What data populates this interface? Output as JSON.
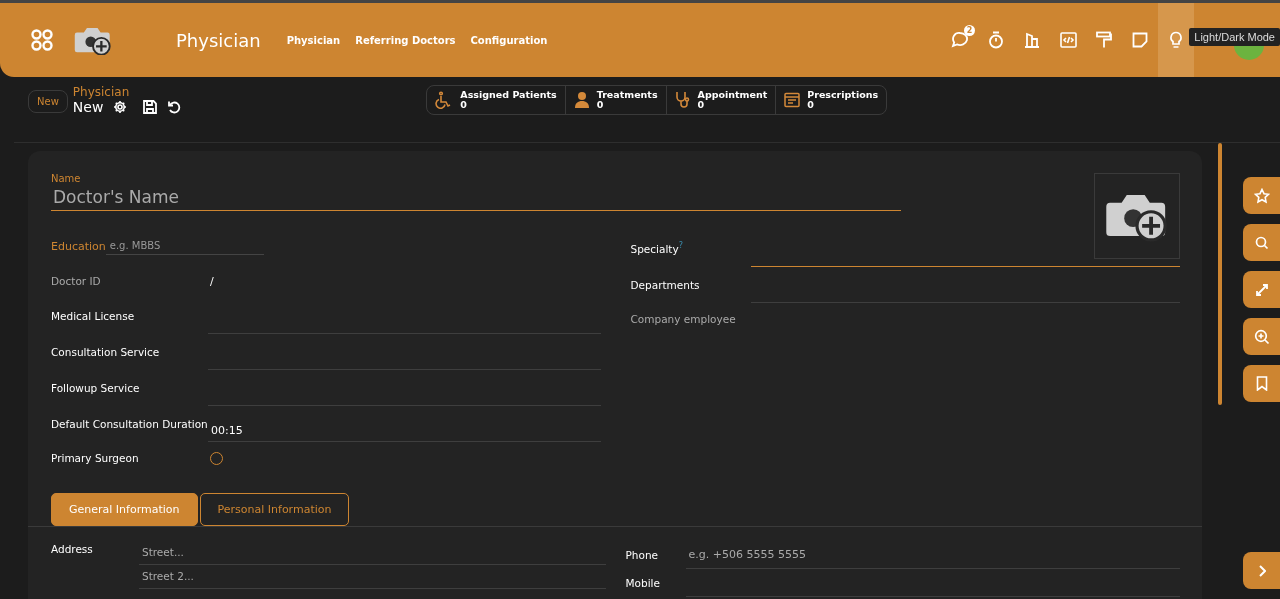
{
  "header": {
    "app_title": "Physician",
    "menu": [
      "Physician",
      "Referring Doctors",
      "Configuration"
    ],
    "systray": [
      {
        "badge": "2",
        "hovered": false
      },
      {
        "hovered": false
      },
      {
        "hovered": false
      },
      {
        "hovered": false
      },
      {
        "hovered": false
      },
      {
        "hovered": false
      },
      {
        "hovered": true
      }
    ],
    "tooltip": "Light/Dark Mode"
  },
  "control_panel": {
    "new_button": "New",
    "breadcrumb": "Physician",
    "record_title": "New"
  },
  "smart_buttons": [
    {
      "label": "Assigned Patients",
      "count": "0"
    },
    {
      "label": "Treatments",
      "count": "0"
    },
    {
      "label": "Appointment",
      "count": "0"
    },
    {
      "label": "Prescriptions",
      "count": "0"
    }
  ],
  "form": {
    "name_label": "Name",
    "name_placeholder": "Doctor's Name",
    "education_label": "Education",
    "education_placeholder": "e.g. MBBS",
    "left_fields": [
      {
        "kind": "readonly",
        "label": "Doctor ID",
        "value": "/",
        "muted": true
      },
      {
        "kind": "input",
        "label": "Medical License",
        "muted": false
      },
      {
        "kind": "input",
        "label": "Consultation Service",
        "muted": false
      },
      {
        "kind": "input",
        "label": "Followup Service",
        "muted": false
      },
      {
        "kind": "input",
        "label": "Default Consultation Duration",
        "value": "00:15",
        "muted": false
      },
      {
        "kind": "radio",
        "label": "Primary Surgeon",
        "checked": false,
        "muted": false
      }
    ],
    "right_fields": [
      {
        "kind": "input",
        "label": "Specialty",
        "help": "?",
        "focused": true,
        "muted": false
      },
      {
        "kind": "input",
        "label": "Departments",
        "focused": false,
        "muted": false
      },
      {
        "kind": "readonly",
        "label": "Company employee",
        "muted": true
      }
    ],
    "tabs": [
      {
        "label": "General Information",
        "selected": true
      },
      {
        "label": "Personal Information",
        "selected": false
      }
    ],
    "address": {
      "label": "Address",
      "street_placeholder": "Street...",
      "street2_placeholder": "Street 2..."
    },
    "contact_fields": [
      {
        "label": "Phone",
        "placeholder": "e.g. +506 5555 5555"
      },
      {
        "label": "Mobile"
      }
    ]
  }
}
